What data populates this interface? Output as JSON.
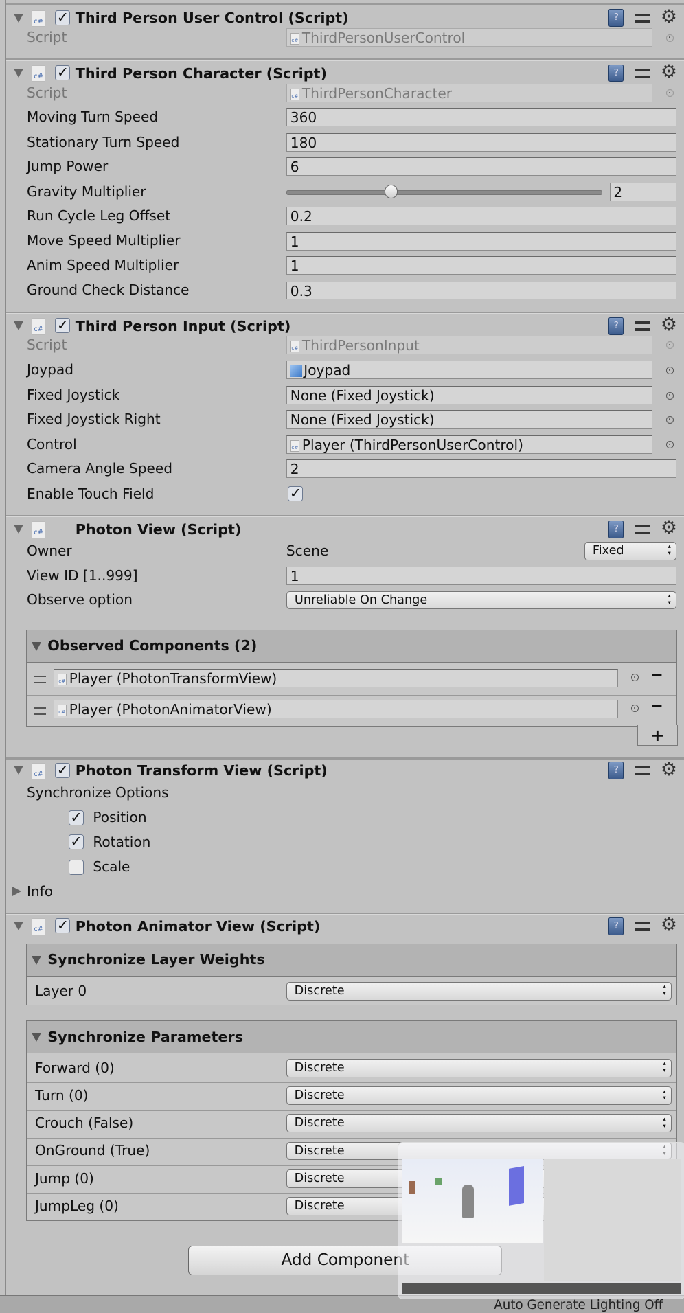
{
  "components": [
    {
      "title": "Third Person User Control (Script)",
      "script_label": "Script",
      "script_value": "ThirdPersonUserControl"
    },
    {
      "title": "Third Person Character (Script)",
      "script_label": "Script",
      "script_value": "ThirdPersonCharacter",
      "fields": [
        {
          "label": "Moving Turn Speed",
          "value": "360"
        },
        {
          "label": "Stationary Turn Speed",
          "value": "180"
        },
        {
          "label": "Jump Power",
          "value": "6"
        },
        {
          "label": "Gravity Multiplier",
          "value": "2",
          "slider_min": 1,
          "slider_max": 4,
          "slider_value": 2
        },
        {
          "label": "Run Cycle Leg Offset",
          "value": "0.2"
        },
        {
          "label": "Move Speed Multiplier",
          "value": "1"
        },
        {
          "label": "Anim Speed Multiplier",
          "value": "1"
        },
        {
          "label": "Ground Check Distance",
          "value": "0.3"
        }
      ]
    },
    {
      "title": "Third Person Input (Script)",
      "script_label": "Script",
      "script_value": "ThirdPersonInput",
      "fields": [
        {
          "label": "Joypad",
          "value": "Joypad"
        },
        {
          "label": "Fixed Joystick",
          "value": "None (Fixed Joystick)"
        },
        {
          "label": "Fixed Joystick Right",
          "value": "None (Fixed Joystick)"
        },
        {
          "label": "Control",
          "value": "Player (ThirdPersonUserControl)"
        },
        {
          "label": "Camera Angle Speed",
          "value": "2"
        },
        {
          "label": "Enable Touch Field",
          "checked": true
        }
      ]
    },
    {
      "title": "Photon View (Script)",
      "owner_label": "Owner",
      "owner_value": "Scene",
      "owner_mode": "Fixed",
      "viewid_label": "View ID [1..999]",
      "viewid_value": "1",
      "observe_label": "Observe option",
      "observe_value": "Unreliable On Change",
      "observed_title": "Observed Components (2)",
      "observed": [
        "Player (PhotonTransformView)",
        "Player (PhotonAnimatorView)"
      ],
      "add_symbol": "+",
      "remove_symbol": "−"
    },
    {
      "title": "Photon Transform View (Script)",
      "sync_label": "Synchronize Options",
      "options": [
        {
          "label": "Position",
          "checked": true
        },
        {
          "label": "Rotation",
          "checked": true
        },
        {
          "label": "Scale",
          "checked": false
        }
      ],
      "info_label": "Info"
    },
    {
      "title": "Photon Animator View (Script)",
      "layer_title": "Synchronize Layer Weights",
      "layers": [
        {
          "label": "Layer 0",
          "value": "Discrete"
        }
      ],
      "param_title": "Synchronize Parameters",
      "params": [
        {
          "label": "Forward (0)",
          "value": "Discrete"
        },
        {
          "label": "Turn (0)",
          "value": "Discrete"
        },
        {
          "label": "Crouch (False)",
          "value": "Discrete"
        },
        {
          "label": "OnGround (True)",
          "value": "Discrete"
        },
        {
          "label": "Jump (0)",
          "value": "Discrete"
        },
        {
          "label": "JumpLeg (0)",
          "value": "Discrete"
        }
      ]
    }
  ],
  "add_component": "Add Component",
  "status_text": "Auto Generate Lighting Off",
  "checkmark": "✓",
  "cs_icon": "c#"
}
